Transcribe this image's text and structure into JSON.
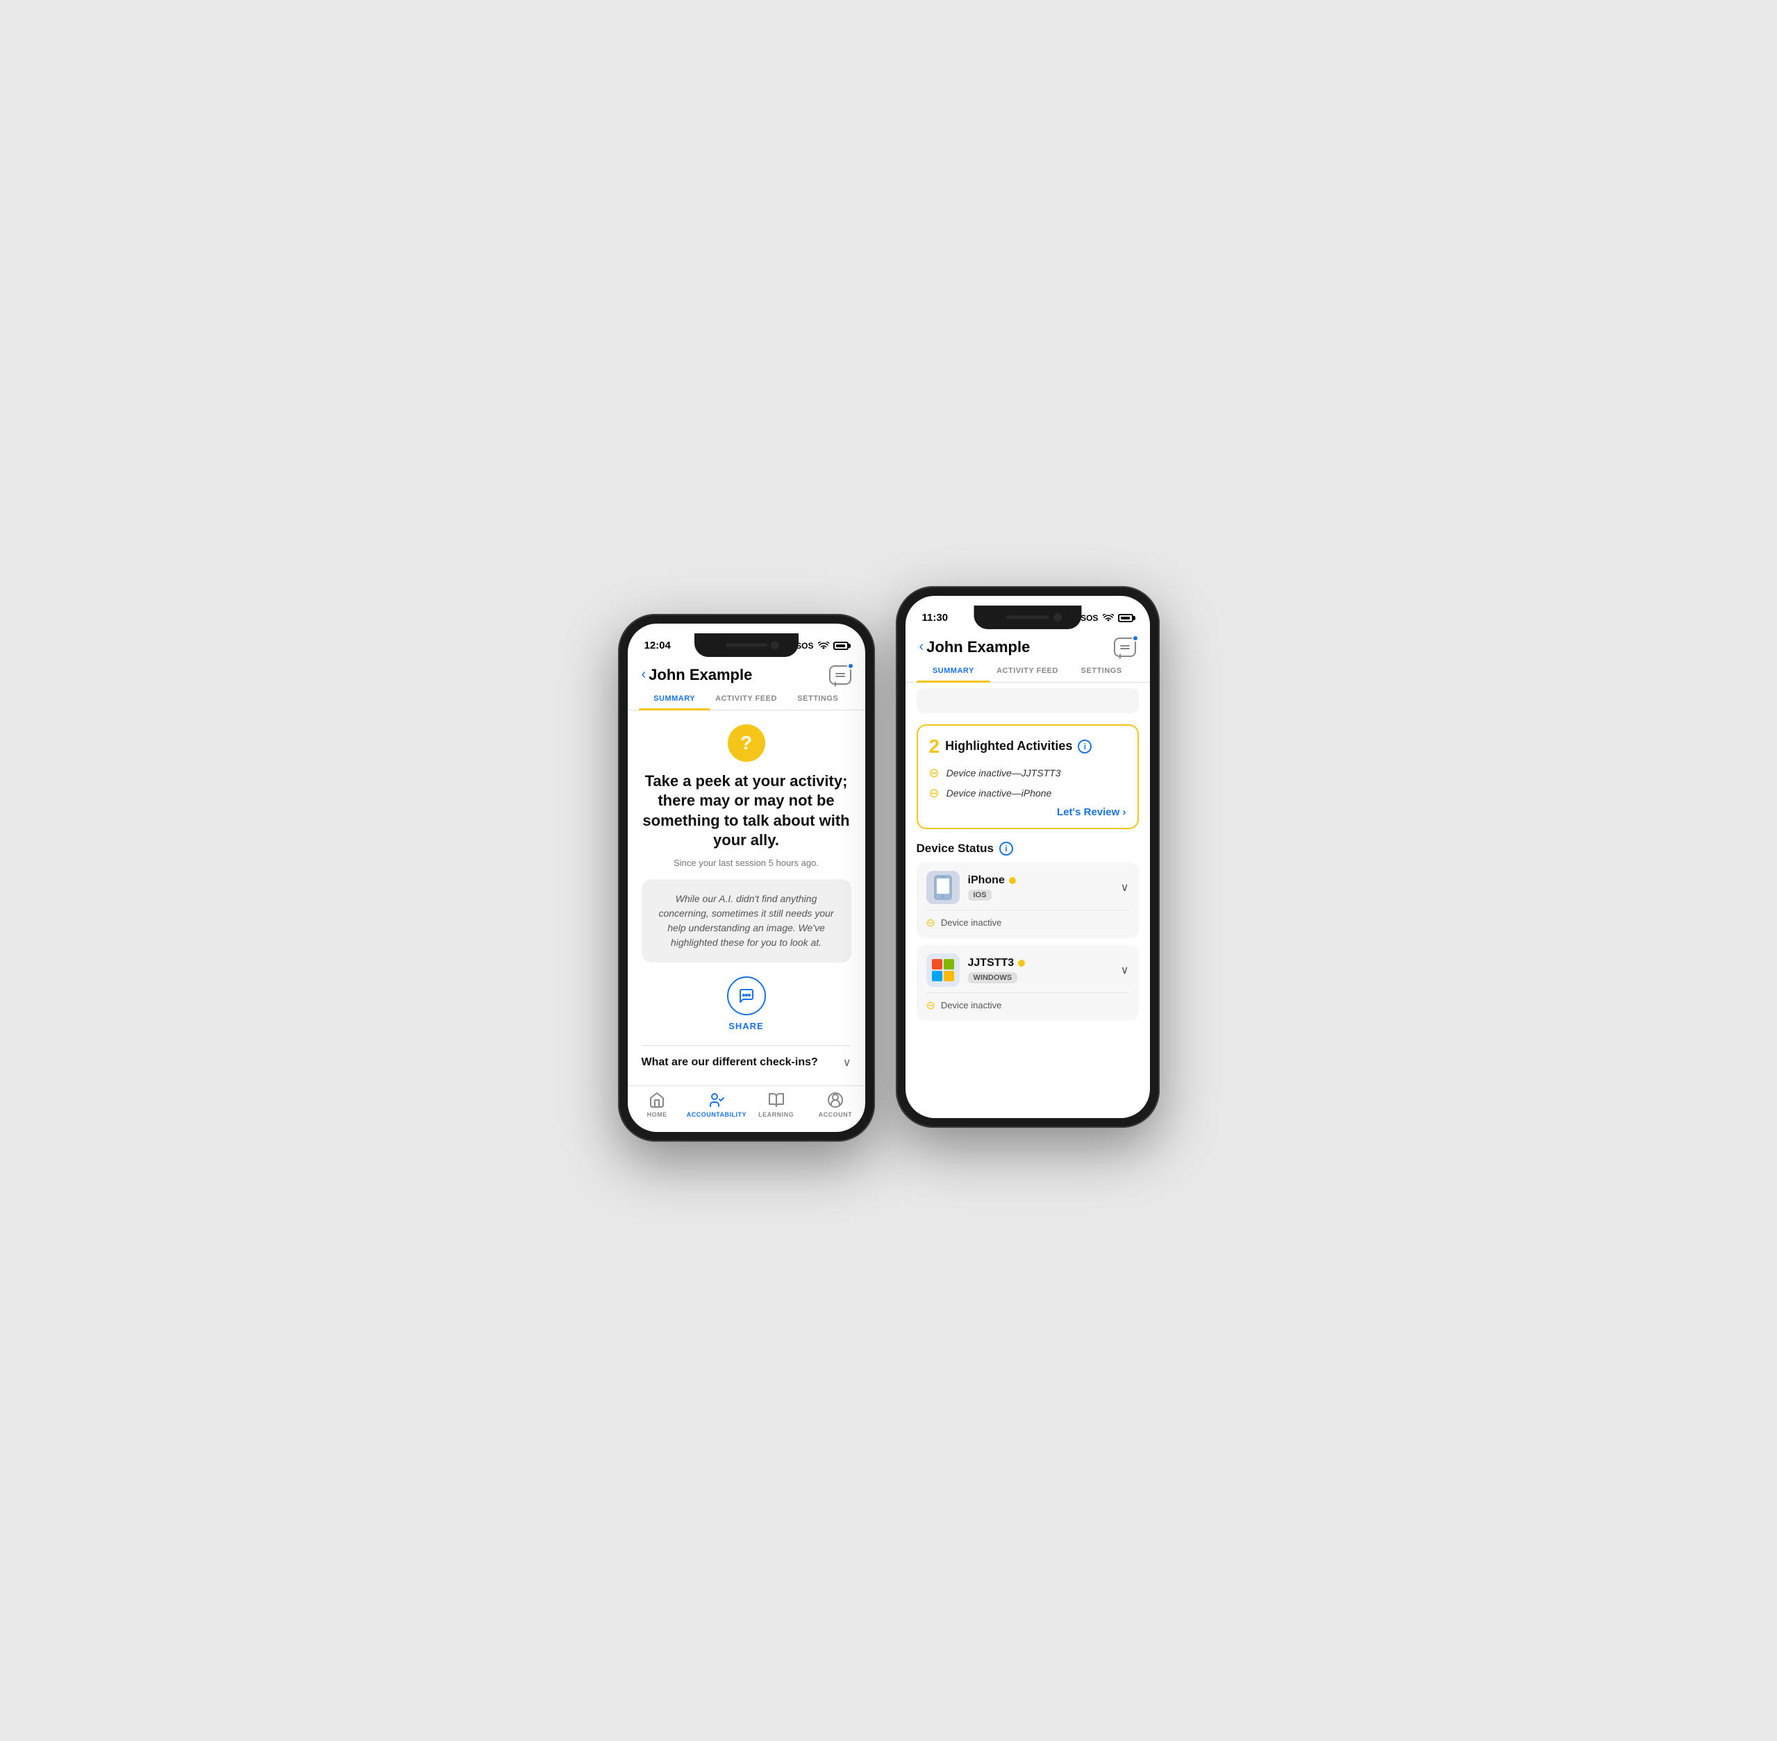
{
  "left_phone": {
    "status_bar": {
      "time": "12:04",
      "sos": "SOS",
      "wifi": "wifi",
      "battery": "battery"
    },
    "header": {
      "back_label": "John Example",
      "chat_icon": "chat-icon"
    },
    "tabs": [
      {
        "label": "SUMMARY",
        "active": true
      },
      {
        "label": "ACTIVITY FEED",
        "active": false
      },
      {
        "label": "SETTINGS",
        "active": false
      }
    ],
    "main": {
      "question_icon": "?",
      "headline": "Take a peek at your activity; there may or may not be something to talk about with your ally.",
      "sub_text": "Since your last session 5 hours ago.",
      "ai_message": "While our A.I. didn't find anything concerning, sometimes it still needs your help understanding an image. We've highlighted these for you to look at.",
      "share_label": "SHARE",
      "checkins_title": "What are our different check-ins?"
    },
    "bottom_nav": [
      {
        "label": "HOME",
        "icon": "home-icon",
        "active": false
      },
      {
        "label": "ACCOUNTABILITY",
        "icon": "accountability-icon",
        "active": true
      },
      {
        "label": "LEARNING",
        "icon": "learning-icon",
        "active": false
      },
      {
        "label": "ACCOUNT",
        "icon": "account-icon",
        "active": false
      }
    ]
  },
  "right_phone": {
    "status_bar": {
      "time": "11:30",
      "sos": "SOS",
      "wifi": "wifi",
      "battery": "battery"
    },
    "header": {
      "back_label": "John Example",
      "chat_icon": "chat-icon"
    },
    "tabs": [
      {
        "label": "SUMMARY",
        "active": true
      },
      {
        "label": "ACTIVITY FEED",
        "active": false
      },
      {
        "label": "SETTINGS",
        "active": false
      }
    ],
    "main": {
      "highlighted_count": "2",
      "highlighted_title": "Highlighted Activities",
      "info_icon": "i",
      "activities": [
        {
          "text": "Device inactive—JJTSTT3"
        },
        {
          "text": "Device inactive—iPhone"
        }
      ],
      "lets_review": "Let's Review",
      "device_status_title": "Device Status",
      "devices": [
        {
          "name": "iPhone",
          "os": "IOS",
          "status": "active",
          "inactive_text": "Device inactive",
          "icon_type": "iphone"
        },
        {
          "name": "JJTSTT3",
          "os": "WINDOWS",
          "status": "active",
          "inactive_text": "Device inactive",
          "icon_type": "windows"
        }
      ]
    }
  },
  "colors": {
    "blue": "#1a73e8",
    "yellow": "#f5c518",
    "gray_bg": "#f0f0f0",
    "text_dark": "#111111",
    "text_gray": "#777777"
  }
}
